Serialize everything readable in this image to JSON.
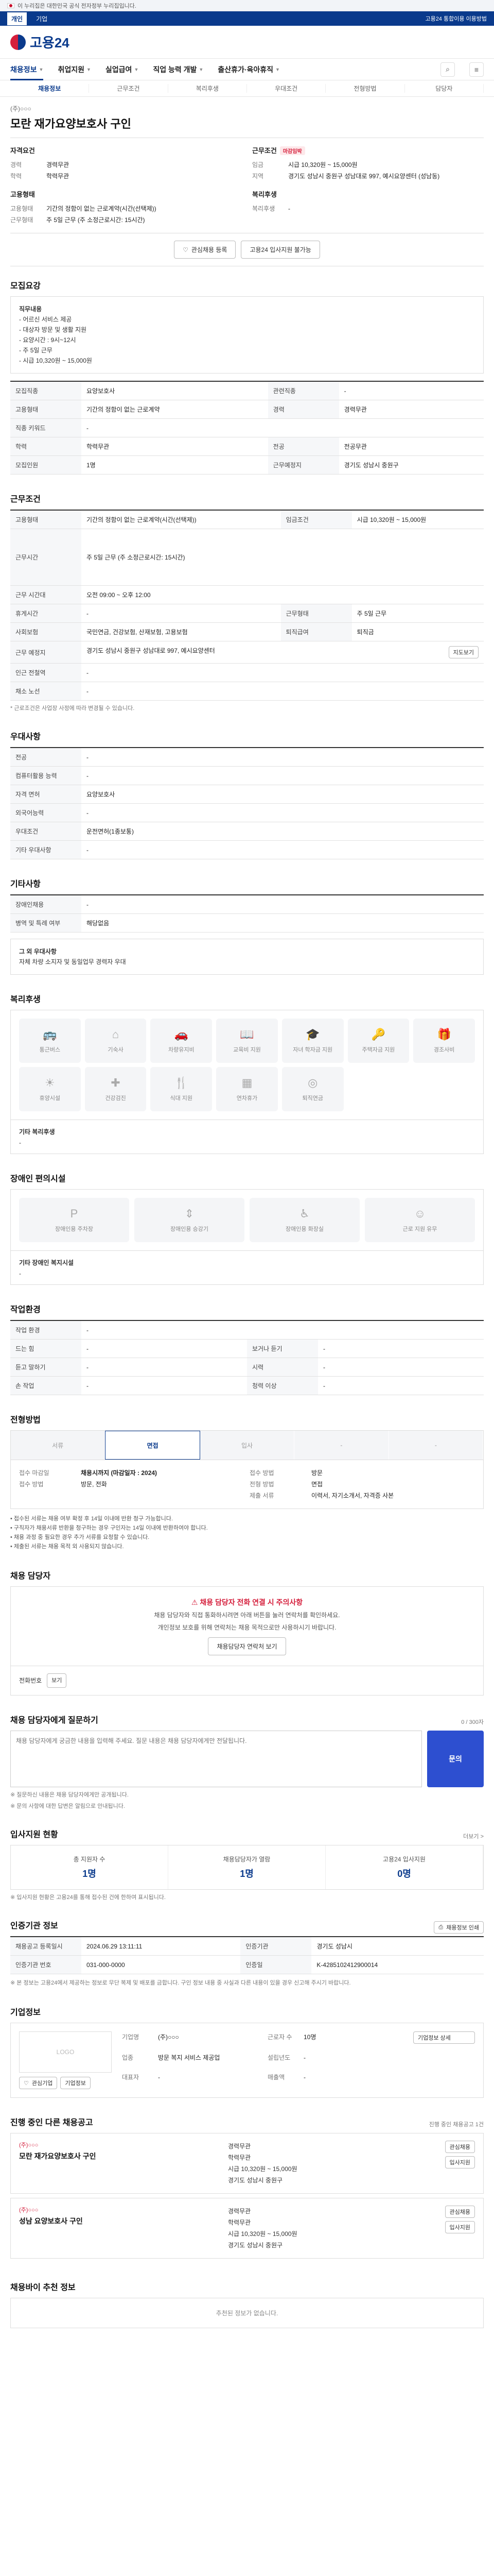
{
  "gov_banner": "이 누리집은 대한민국 공식 전자정부 누리집입니다.",
  "topbar": {
    "tabs": [
      "개인",
      "기업"
    ],
    "right_link": "고용24 통합이용 이용방법"
  },
  "logo": "고용24",
  "gnb": {
    "menus": [
      "채용정보",
      "취업지원",
      "실업급여",
      "직업 능력 개발",
      "출산휴가·육아휴직"
    ]
  },
  "subtabs": [
    "채용정보",
    "근무조건",
    "복리후생",
    "우대조건",
    "전형방법",
    "담당자"
  ],
  "job": {
    "company": "(주)○○○",
    "title": "모란 재가요양보호사 구인",
    "summary_left": {
      "heading": "자격요건",
      "rows": [
        {
          "k": "경력",
          "v": "경력무관"
        },
        {
          "k": "학력",
          "v": "학력무관"
        }
      ],
      "heading2": "고용형태",
      "rows2": [
        {
          "k": "고용형태",
          "v": "기간의 정함이 없는 근로계약(시간(선택제))"
        },
        {
          "k": "근무형태",
          "v": "주 5일 근무 (주 소정근로시간: 15시간)"
        }
      ]
    },
    "summary_right": {
      "heading": "근무조건",
      "badge": "마감임박",
      "rows": [
        {
          "k": "임금",
          "v": "시급 10,320원 ~ 15,000원"
        },
        {
          "k": "지역",
          "v": "경기도 성남시 중원구 성남대로 997, 예시요양센터 (성남동)"
        }
      ],
      "heading2": "복리후생",
      "rows2": [
        {
          "k": "복리후생",
          "v": "-"
        }
      ]
    }
  },
  "buttons": {
    "scrap": "관심채용 등록",
    "share": "고용24 입사지원 불가능"
  },
  "recruit": {
    "title": "모집요강",
    "box_title": "직무내용",
    "box_lines": [
      "- 어르신 서비스 제공",
      "- 대상자 방문 및 생활 지원",
      "- 요양시간 : 9시~12시",
      "- 주 5일 근무",
      "- 시급 10,320원 ~ 15,000원"
    ],
    "rows": [
      [
        "모집직종",
        "요양보호사",
        "관련직종",
        "-"
      ],
      [
        "고용형태",
        "기간의 정함이 없는 근로계약",
        "경력",
        "경력무관"
      ],
      [
        "직종 키워드",
        "-",
        "",
        ""
      ],
      [
        "학력",
        "학력무관",
        "전공",
        "전공무관"
      ],
      [
        "모집인원",
        "1명",
        "근무예정지",
        "경기도 성남시 중원구"
      ]
    ]
  },
  "conditions": {
    "title": "근무조건",
    "rows": [
      [
        "고용형태",
        "기간의 정함이 없는 근로계약(시간(선택제))",
        "임금조건",
        "시급 10,320원 ~ 15,000원"
      ],
      [
        "근무시간",
        "주 5일 근무 (주 소정근로시간: 15시간)",
        "",
        ""
      ],
      [
        "근무 시간대",
        "오전 09:00 ~ 오후 12:00",
        "",
        ""
      ],
      [
        "휴게시간",
        "-",
        "근무형태",
        "주 5일 근무"
      ],
      [
        "사회보험",
        "국민연금, 건강보험, 산재보험, 고용보험",
        "퇴직급여",
        "퇴직금"
      ],
      [
        "근무 예정지",
        "경기도 성남시 중원구 성남대로 997, 예시요양센터",
        "",
        ""
      ],
      [
        "인근 전철역",
        "-",
        "",
        ""
      ],
      [
        "채소 노선",
        "-",
        "",
        ""
      ]
    ],
    "map_button": "지도보기",
    "note": "* 근로조건은 사업장 사정에 따라 변경될 수 있습니다."
  },
  "preference": {
    "title": "우대사항",
    "rows": [
      [
        "전공",
        "-"
      ],
      [
        "컴퓨터활용 능력",
        "-"
      ],
      [
        "자격 면허",
        "요양보호사"
      ],
      [
        "외국어능력",
        "-"
      ],
      [
        "우대조건",
        "운전면허(1종보통)"
      ],
      [
        "기타 우대사항",
        "-"
      ]
    ]
  },
  "others": {
    "title": "기타사항",
    "rows": [
      [
        "장애인채용",
        "-"
      ],
      [
        "병역 및 특례 여부",
        "해당없음"
      ]
    ],
    "extra_title": "그 외 우대사항",
    "extra_text": "자체 차량 소지자 및 동일업무 경력자 우대"
  },
  "welfare": {
    "title": "복리후생",
    "icons": [
      {
        "label": "통근버스",
        "icon": "bus-icon",
        "glyph": "🚌"
      },
      {
        "label": "기숙사",
        "icon": "house-icon",
        "glyph": "⌂"
      },
      {
        "label": "차량유지비",
        "icon": "car-icon",
        "glyph": "🚗"
      },
      {
        "label": "교육비 지원",
        "icon": "book-icon",
        "glyph": "📖"
      },
      {
        "label": "자녀 학자금 지원",
        "icon": "cap-icon",
        "glyph": "🎓"
      },
      {
        "label": "주택자금 지원",
        "icon": "key-icon",
        "glyph": "🔑"
      },
      {
        "label": "경조사비",
        "icon": "gift-icon",
        "glyph": "🎁"
      },
      {
        "label": "휴양시설",
        "icon": "sun-icon",
        "glyph": "☀"
      },
      {
        "label": "건강검진",
        "icon": "health-icon",
        "glyph": "✚"
      },
      {
        "label": "식대 지원",
        "icon": "meal-icon",
        "glyph": "🍴"
      },
      {
        "label": "연차휴가",
        "icon": "calendar-icon",
        "glyph": "▦"
      },
      {
        "label": "퇴직연금",
        "icon": "coin-icon",
        "glyph": "◎"
      }
    ],
    "sub_title": "기타 복리후생",
    "sub_text": "-"
  },
  "disability": {
    "title": "장애인 편의시설",
    "icons": [
      {
        "label": "장애인용 주차장",
        "icon": "parking-icon",
        "glyph": "P"
      },
      {
        "label": "장애인용 승강기",
        "icon": "elevator-icon",
        "glyph": "⇕"
      },
      {
        "label": "장애인용 화장실",
        "icon": "toilet-icon",
        "glyph": "♿"
      },
      {
        "label": "근로 지원 유무",
        "icon": "support-icon",
        "glyph": "☺"
      }
    ],
    "sub_title": "기타 장애인 복지시설",
    "sub_text": "-"
  },
  "workenv": {
    "title": "작업환경",
    "rows": [
      [
        "작업 환경",
        "-",
        "",
        ""
      ],
      [
        "드는 힘",
        "-",
        "보거나 듣기",
        "-"
      ],
      [
        "듣고 말하기",
        "-",
        "시력",
        "-"
      ],
      [
        "손 작업",
        "-",
        "청력 이상",
        "-"
      ]
    ]
  },
  "process": {
    "title": "전형방법",
    "steps": [
      "서류",
      "면접",
      "입사",
      "-",
      "-"
    ],
    "active": 1,
    "left": [
      {
        "k": "접수 마감일",
        "v": "채용시까지 (마감일자 : 2024)"
      },
      {
        "k": "접수 방법",
        "v": "방문, 전화"
      }
    ],
    "right": [
      {
        "k": "접수 방법",
        "v": "방문"
      },
      {
        "k": "전형 방법",
        "v": "면접"
      },
      {
        "k": "제출 서류",
        "v": "이력서, 자기소개서, 자격증 사본"
      }
    ],
    "bullets": [
      "접수된 서류는 채용 여부 확정 후 14일 이내에 반환 청구 가능합니다.",
      "구직자가 채용서류 반환을 청구하는 경우 구인자는 14일 이내에 반환하여야 합니다.",
      "채용 과정 중 필요한 경우 추가 서류를 요청할 수 있습니다.",
      "제출된 서류는 채용 목적 외 사용되지 않습니다."
    ]
  },
  "manager": {
    "title": "채용 담당자",
    "warn": "채용 담당자 전화 연결 시 주의사항",
    "lines": [
      "채용 담당자와 직접 통화하시려면 아래 버튼을 눌러 연락처를 확인하세요.",
      "개인정보 보호를 위해 연락처는 채용 목적으로만 사용하시기 바랍니다."
    ],
    "btn": "채용담당자 연락처 보기",
    "phone_label": "전화번호",
    "phone_btn": "보기"
  },
  "inquiry": {
    "title": "채용 담당자에게 질문하기",
    "counter": "0 / 300자",
    "placeholder": "채용 담당자에게 궁금한 내용을 입력해 주세요. 질문 내용은 채용 담당자에게만 전달됩니다.",
    "submit": "문의",
    "notes": [
      "※ 질문하신 내용은 채용 담당자에게만 공개됩니다.",
      "※ 문의 사항에 대한 답변은 알림으로 안내됩니다."
    ]
  },
  "apply_status": {
    "title": "입사지원 현황",
    "more": "더보기 >",
    "stats": [
      {
        "label": "총 지원자 수",
        "num": "1명"
      },
      {
        "label": "채용담당자가 열람",
        "num": "1명"
      },
      {
        "label": "고용24 입사지원",
        "num": "0명"
      }
    ],
    "note": "※ 입사지원 현황은 고용24를 통해 접수된 건에 한하여 표시됩니다."
  },
  "info": {
    "title": "인증기관 정보",
    "print_btn": "채용정보 인쇄",
    "rows": [
      [
        "채용공고 등록일시",
        "2024.06.29 13:11:11",
        "인증기관",
        "경기도 성남시"
      ],
      [
        "인증기관 번호",
        "031-000-0000",
        "인증일",
        "K-4285102412900014"
      ]
    ],
    "rights": "※ 본 정보는 고용24에서 제공하는 정보로 무단 복제 및 배포를 금합니다. 구인 정보 내용 중 사실과 다른 내용이 있을 경우 신고해 주시기 바랍니다."
  },
  "company": {
    "title": "기업정보",
    "logo_text": "LOGO",
    "rows": [
      {
        "k": "기업명",
        "v": "(주)○○○"
      },
      {
        "k": "업종",
        "v": "방문 복지 서비스 제공업"
      },
      {
        "k": "대표자",
        "v": "-"
      },
      {
        "k": "근로자 수",
        "v": "10명"
      },
      {
        "k": "설립년도",
        "v": "-"
      },
      {
        "k": "매출액",
        "v": "-"
      }
    ],
    "actions": [
      "관심기업",
      "기업정보"
    ],
    "detail_btn": "기업정보 상세"
  },
  "related": {
    "title": "진행 중인 다른 채용공고",
    "note": "진행 중인 채용공고 1건",
    "listings": [
      {
        "cname": "(주)○○○",
        "title": "모란 재가요양보호사 구인",
        "meta": [
          "경력무관",
          "학력무관",
          "시급 10,320원 ~ 15,000원",
          "경기도 성남시 중원구"
        ],
        "btns": [
          "관심채용",
          "입사지원"
        ]
      },
      {
        "cname": "(주)○○○",
        "title": "성남 요양보호사 구인",
        "meta": [
          "경력무관",
          "학력무관",
          "시급 10,320원 ~ 15,000원",
          "경기도 성남시 중원구"
        ],
        "btns": [
          "관심채용",
          "입사지원"
        ]
      }
    ]
  },
  "recommend": {
    "title": "채용바이 추천 정보",
    "empty": "추천된 정보가 없습니다."
  }
}
